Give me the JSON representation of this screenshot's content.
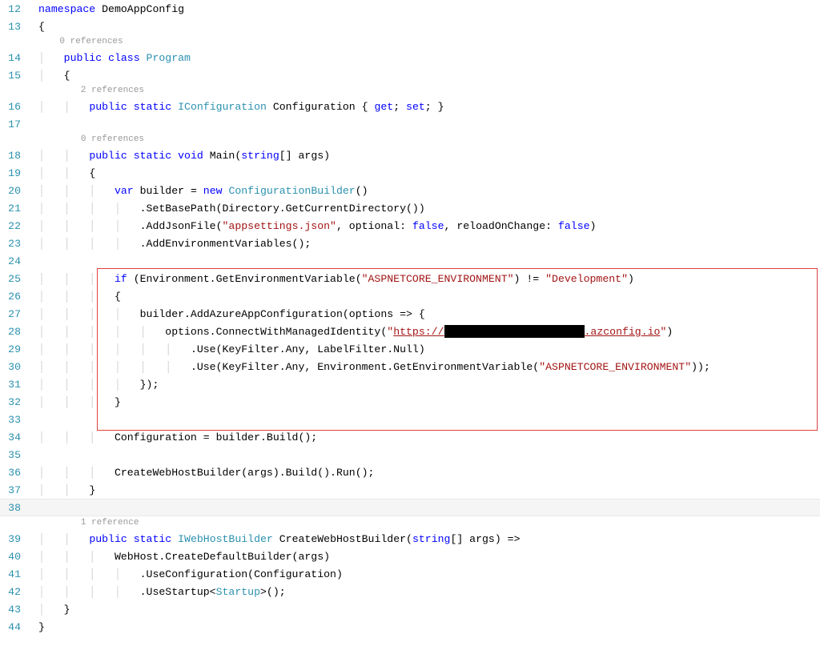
{
  "gutter": {
    "ln12": "12",
    "ln13": "13",
    "ln14": "14",
    "ln15": "15",
    "ln16": "16",
    "ln17": "17",
    "ln18": "18",
    "ln19": "19",
    "ln20": "20",
    "ln21": "21",
    "ln22": "22",
    "ln23": "23",
    "ln24": "24",
    "ln25": "25",
    "ln26": "26",
    "ln27": "27",
    "ln28": "28",
    "ln29": "29",
    "ln30": "30",
    "ln31": "31",
    "ln32": "32",
    "ln33": "33",
    "ln34": "34",
    "ln35": "35",
    "ln36": "36",
    "ln37": "37",
    "ln38": "38",
    "ln39": "39",
    "ln40": "40",
    "ln41": "41",
    "ln42": "42",
    "ln43": "43",
    "ln44": "44"
  },
  "codelens": {
    "ref0a": "0 references",
    "ref2": "2 references",
    "ref0b": "0 references",
    "ref1": "1 reference"
  },
  "code": {
    "l12": {
      "namespace": "namespace",
      "ns": " DemoAppConfig"
    },
    "l13": {
      "t": "{"
    },
    "l14": {
      "public": "public",
      "class": "class",
      "name": " Program"
    },
    "l15": {
      "t": "{"
    },
    "l16": {
      "public": "public",
      "static": "static",
      "type": "IConfiguration",
      "name": " Configuration { ",
      "get": "get",
      "semi1": "; ",
      "set": "set",
      "semi2": "; }"
    },
    "l18": {
      "public": "public",
      "static": "static",
      "void": "void",
      "name": " Main(",
      "string": "string",
      "rest": "[] args)"
    },
    "l19": {
      "t": "{"
    },
    "l20": {
      "var": "var",
      "rest1": " builder = ",
      "new": "new",
      "type": " ConfigurationBuilder",
      "rest2": "()"
    },
    "l21": {
      "t": ".SetBasePath(Directory.GetCurrentDirectory())"
    },
    "l22": {
      "a": ".AddJsonFile(",
      "s": "\"appsettings.json\"",
      "b": ", optional: ",
      "false1": "false",
      "c": ", reloadOnChange: ",
      "false2": "false",
      "d": ")"
    },
    "l23": {
      "t": ".AddEnvironmentVariables();"
    },
    "l25": {
      "if": "if",
      "a": " (Environment.GetEnvironmentVariable(",
      "s": "\"ASPNETCORE_ENVIRONMENT\"",
      "b": ") != ",
      "s2": "\"Development\"",
      "c": ")"
    },
    "l26": {
      "t": "{"
    },
    "l27": {
      "t": "builder.AddAzureAppConfiguration(options => {"
    },
    "l28": {
      "a": "options.ConnectWithManagedIdentity(",
      "s1": "\"",
      "url_a": "https://",
      "url_b": ".azconfig.io",
      "s2": "\"",
      "b": ")"
    },
    "l29": {
      "t": ".Use(KeyFilter.Any, LabelFilter.Null)"
    },
    "l30": {
      "a": ".Use(KeyFilter.Any, Environment.GetEnvironmentVariable(",
      "s": "\"ASPNETCORE_ENVIRONMENT\"",
      "b": "));"
    },
    "l31": {
      "t": "});"
    },
    "l32": {
      "t": "}"
    },
    "l34": {
      "t": "Configuration = builder.Build();"
    },
    "l36": {
      "t": "CreateWebHostBuilder(args).Build().Run();"
    },
    "l37": {
      "t": "}"
    },
    "l39": {
      "public": "public",
      "static": "static",
      "type": "IWebHostBuilder",
      "name": " CreateWebHostBuilder(",
      "string": "string",
      "rest": "[] args) =>"
    },
    "l40": {
      "t": "WebHost.CreateDefaultBuilder(args)"
    },
    "l41": {
      "t": ".UseConfiguration(Configuration)"
    },
    "l42": {
      "a": ".UseStartup<",
      "type": "Startup",
      "b": ">();"
    },
    "l43": {
      "t": "}"
    },
    "l44": {
      "t": "}"
    }
  }
}
